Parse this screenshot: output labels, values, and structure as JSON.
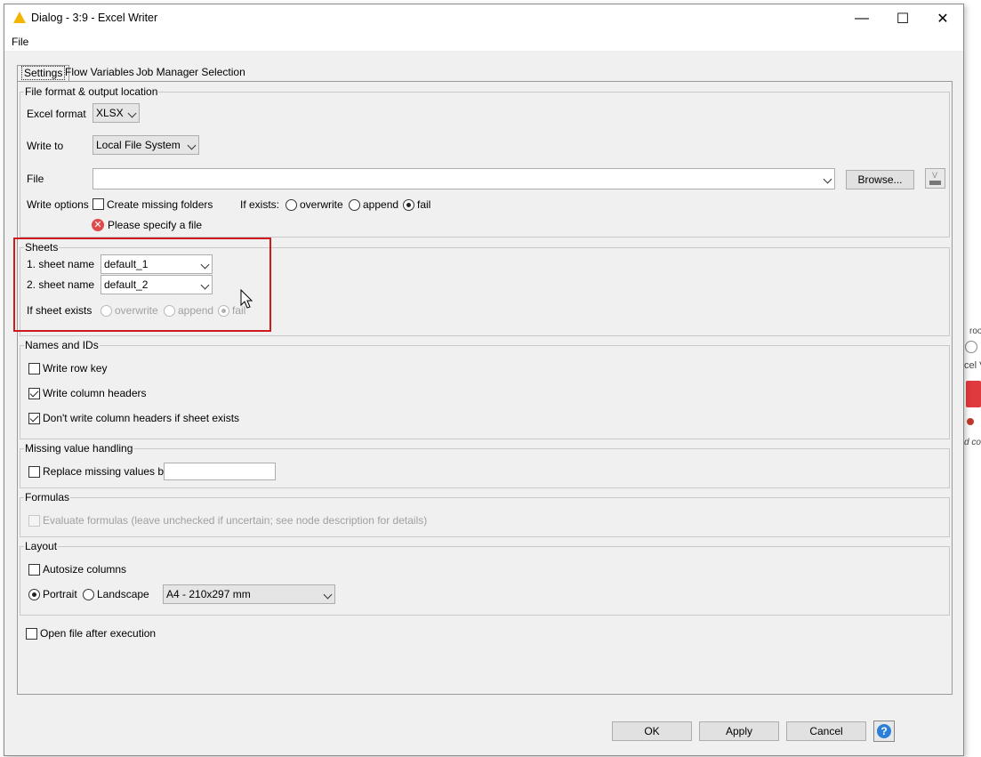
{
  "window": {
    "title": "Dialog - 3:9 - Excel Writer",
    "menu_file": "File",
    "minimize": "—",
    "maximize": "☐",
    "close": "✕"
  },
  "tabs": [
    {
      "label": "Settings",
      "active": true
    },
    {
      "label": "Flow Variables",
      "active": false
    },
    {
      "label": "Job Manager Selection",
      "active": false
    }
  ],
  "file_format": {
    "group_title": "File format & output location",
    "excel_format_label": "Excel format",
    "excel_format_value": "XLSX",
    "write_to_label": "Write to",
    "write_to_value": "Local File System",
    "file_label": "File",
    "file_value": "",
    "browse_label": "Browse...",
    "write_options_label": "Write options",
    "create_missing_folders": {
      "label": "Create missing folders",
      "checked": false
    },
    "if_exists_label": "If exists:",
    "if_exists_options": [
      {
        "label": "overwrite",
        "selected": false
      },
      {
        "label": "append",
        "selected": false
      },
      {
        "label": "fail",
        "selected": true
      }
    ],
    "error_message": "Please specify a file"
  },
  "sheets": {
    "group_title": "Sheets",
    "sheet1_label": "1. sheet name",
    "sheet1_value": "default_1",
    "sheet2_label": "2. sheet name",
    "sheet2_value": "default_2",
    "if_sheet_exists_label": "If sheet exists",
    "if_sheet_exists_options": [
      {
        "label": "overwrite",
        "selected": false
      },
      {
        "label": "append",
        "selected": false
      },
      {
        "label": "fail",
        "selected": true
      }
    ]
  },
  "names_ids": {
    "group_title": "Names and IDs",
    "write_row_key": {
      "label": "Write row key",
      "checked": false
    },
    "write_column_headers": {
      "label": "Write column headers",
      "checked": true
    },
    "dont_write_headers": {
      "label": "Don't write column headers if sheet exists",
      "checked": true
    }
  },
  "missing_values": {
    "group_title": "Missing value handling",
    "replace_missing": {
      "label": "Replace missing values by",
      "checked": false
    },
    "replace_value": ""
  },
  "formulas": {
    "group_title": "Formulas",
    "evaluate": {
      "label": "Evaluate formulas (leave unchecked if uncertain; see node description for details)",
      "checked": false
    }
  },
  "layout": {
    "group_title": "Layout",
    "autosize": {
      "label": "Autosize columns",
      "checked": false
    },
    "portrait_label": "Portrait",
    "landscape_label": "Landscape",
    "paper_size": "A4 - 210x297 mm"
  },
  "open_after": {
    "label": "Open file after execution",
    "checked": false
  },
  "buttons": {
    "ok": "OK",
    "apply": "Apply",
    "cancel": "Cancel",
    "help": "?"
  },
  "background": {
    "text1": "root",
    "text2": "cel V",
    "text3": "d co"
  },
  "colors": {
    "accent_warning": "#f2b600",
    "highlight_red": "#d0191f",
    "error_red": "#e04a4a",
    "help_blue": "#2b7fd8"
  }
}
